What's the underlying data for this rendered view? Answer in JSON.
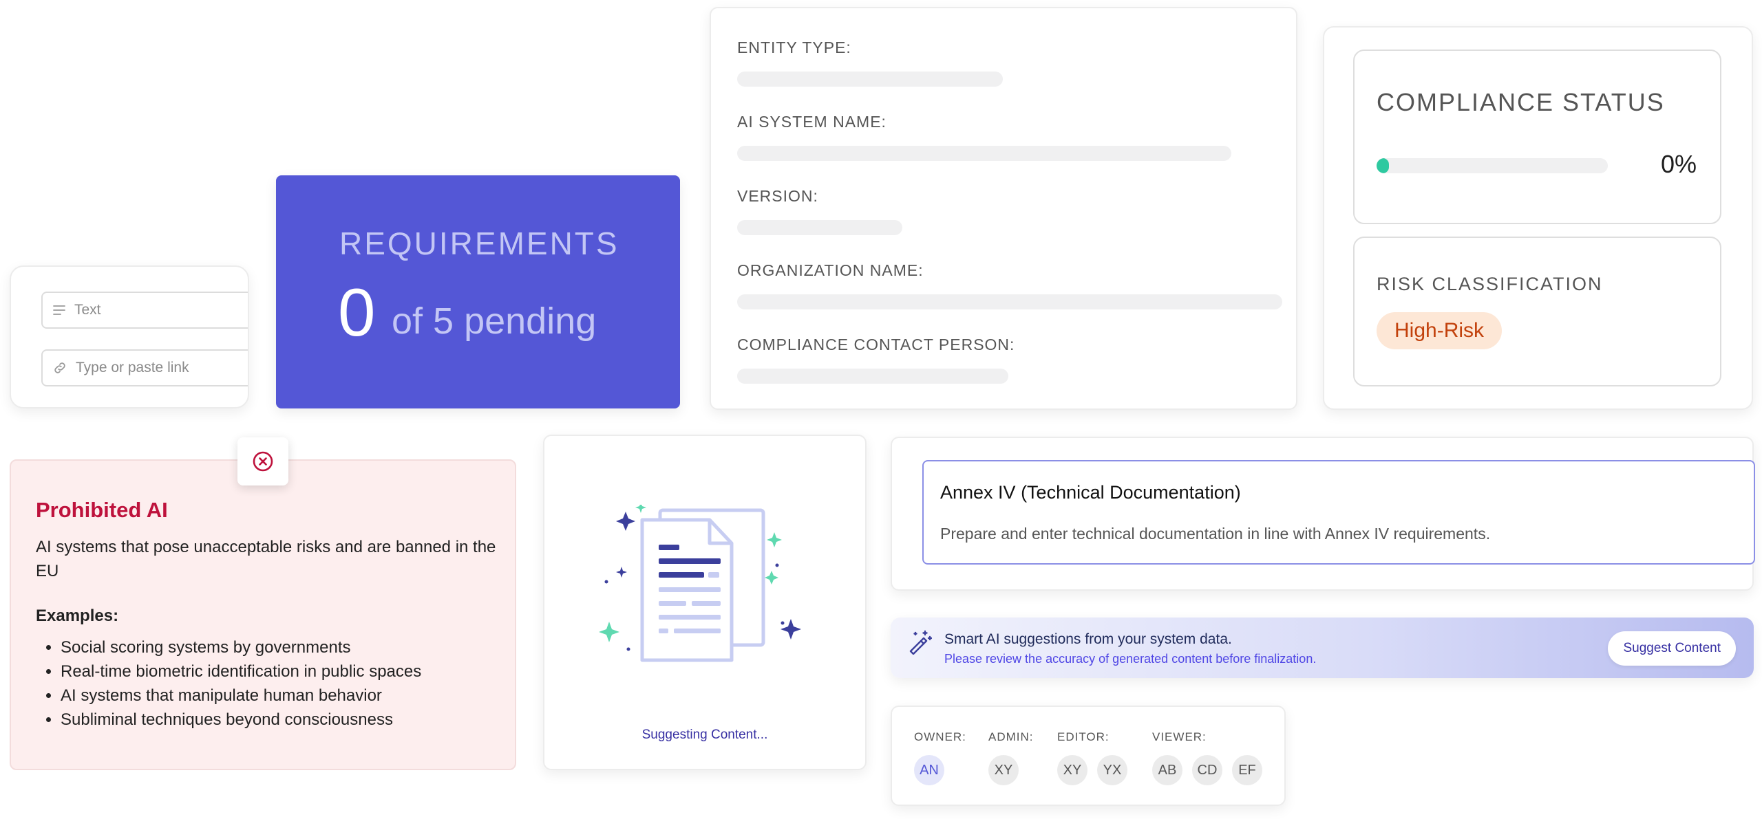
{
  "inputs": {
    "text_placeholder": "Text",
    "link_placeholder": "Type or paste link"
  },
  "requirements": {
    "title": "REQUIREMENTS",
    "count": "0",
    "suffix": "of 5 pending",
    "completed": 0,
    "total": 5,
    "bg_color": "#5457d6"
  },
  "entity_form": {
    "fields": [
      {
        "label": "ENTITY TYPE:"
      },
      {
        "label": "AI SYSTEM NAME:"
      },
      {
        "label": "VERSION:"
      },
      {
        "label": "ORGANIZATION NAME:"
      },
      {
        "label": "COMPLIANCE CONTACT PERSON:"
      }
    ]
  },
  "compliance": {
    "status_title": "COMPLIANCE STATUS",
    "status_percent": "0%",
    "status_value": 0,
    "progress_color": "#2ec9a0",
    "risk_title": "RISK CLASSIFICATION",
    "risk_badge": "High-Risk",
    "risk_color": "#c2410c"
  },
  "prohibited": {
    "title": "Prohibited AI",
    "description": "AI systems that pose unacceptable risks and are banned in the EU",
    "examples_label": "Examples:",
    "examples": [
      "Social scoring systems by governments",
      "Real-time biometric identification in public spaces",
      "AI systems that manipulate human behavior",
      "Subliminal techniques beyond consciousness"
    ],
    "title_color": "#be123c"
  },
  "suggesting": {
    "status_text": "Suggesting Content..."
  },
  "annex": {
    "title": "Annex IV (Technical Documentation)",
    "description": "Prepare and enter technical documentation in line with Annex IV requirements."
  },
  "smart_ai": {
    "title": "Smart AI suggestions from your system data.",
    "subtitle": "Please review the accuracy of generated content before finalization.",
    "button_label": "Suggest Content"
  },
  "roles": {
    "owner": {
      "label": "OWNER:",
      "members": [
        "AN"
      ]
    },
    "admin": {
      "label": "ADMIN:",
      "members": [
        "XY"
      ]
    },
    "editor": {
      "label": "EDITOR:",
      "members": [
        "XY",
        "YX"
      ]
    },
    "viewer": {
      "label": "VIEWER:",
      "members": [
        "AB",
        "CD",
        "EF"
      ]
    }
  }
}
